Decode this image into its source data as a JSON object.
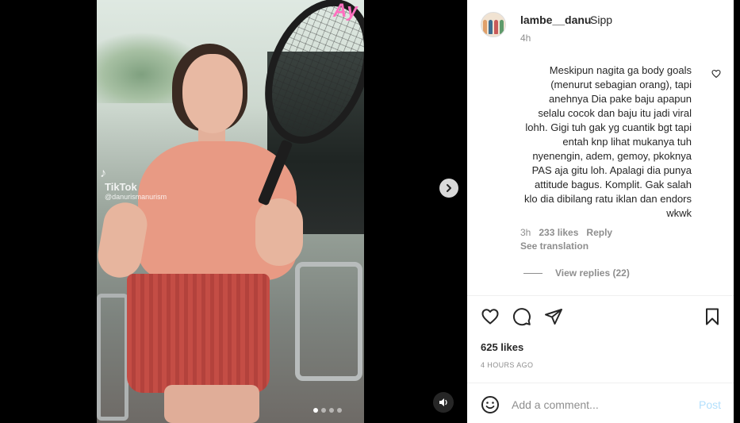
{
  "media": {
    "overlay_text": "Ay",
    "watermark": {
      "logo": "♪",
      "brand": "TikTok",
      "user": "@danurismanurism"
    },
    "carousel": {
      "total": 4,
      "active": 1
    },
    "icons": {
      "next": "chevron-right-icon",
      "audio": "speaker-icon"
    }
  },
  "post": {
    "username": "lambe__danu",
    "caption": "Sipp",
    "time_ago": "4h",
    "likes_label": "625 likes",
    "date_label": "4 HOURS AGO"
  },
  "comment": {
    "text": "Meskipun nagita ga body goals (menurut sebagian orang), tapi anehnya Dia pake baju apapun selalu cocok dan baju itu jadi viral lohh. Gigi tuh gak yg cuantik bgt tapi entah knp lihat mukanya tuh nyenengin, adem, gemoy, pkoknya PAS aja gitu loh. Apalagi dia punya attitude bagus. Komplit. Gak salah klo dia dibilang ratu iklan dan endors wkwk",
    "time": "3h",
    "likes": "233 likes",
    "reply": "Reply",
    "see_translation": "See translation",
    "view_replies": "View replies (22)"
  },
  "actions": {
    "icons": [
      "heart-icon",
      "comment-icon",
      "share-icon",
      "bookmark-icon"
    ]
  },
  "add_comment": {
    "placeholder": "Add a comment...",
    "post_label": "Post"
  },
  "colors": {
    "text": "#262626",
    "secondary": "#8e8e8e",
    "post_disabled": "#b2dffc",
    "divider": "#efefef"
  }
}
